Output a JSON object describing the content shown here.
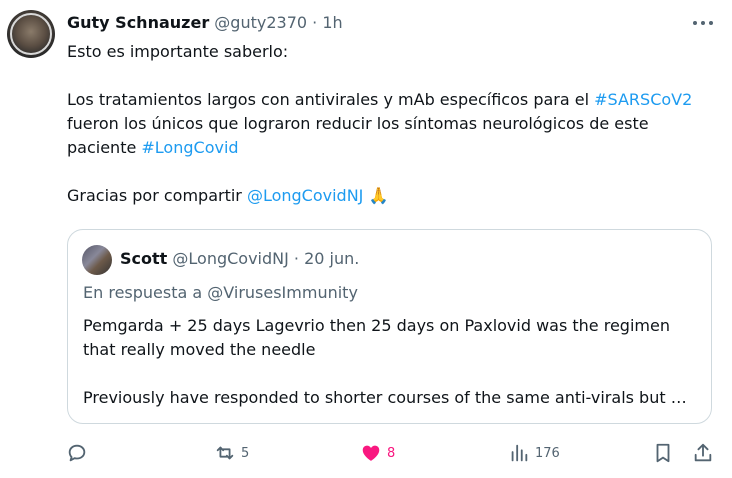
{
  "tweet": {
    "author_name": "Guty Schnauzer",
    "author_handle": "@guty2370",
    "separator": "·",
    "time": "1h",
    "line1": "Esto es importante saberlo:",
    "para2_text_a": "Los tratamientos largos con antivirales y mAb específicos para el ",
    "hashtag1": "#SARSCoV2",
    "para2_text_b": "fueron los únicos que lograron reducir los síntomas neurológicos de este paciente ",
    "hashtag2": "#LongCovid",
    "para3_text": "Gracias por compartir ",
    "mention": "@LongCovidNJ",
    "emoji": "🙏"
  },
  "quote": {
    "author_name": "Scott",
    "author_handle": "@LongCovidNJ",
    "separator": "·",
    "date": "20 jun.",
    "reply_prefix": "En respuesta a ",
    "reply_to": "@VirusesImmunity",
    "line1": "Pemgarda + 25 days Lagevrio then 25  days on Paxlovid was the regimen that really moved the needle",
    "line2": "Previously have responded to shorter courses of the same anti-virals but …"
  },
  "actions": {
    "reply_icon": "reply-icon",
    "retweet_icon": "retweet-icon",
    "retweet_count": "5",
    "like_icon": "heart-filled-icon",
    "like_count": "8",
    "views_icon": "views-icon",
    "views_count": "176",
    "bookmark_icon": "bookmark-icon",
    "share_icon": "share-icon"
  },
  "colors": {
    "link": "#1d9bf0",
    "like": "#f91880",
    "muted": "#536471",
    "text": "#0f1419",
    "border": "#cfd9de"
  }
}
